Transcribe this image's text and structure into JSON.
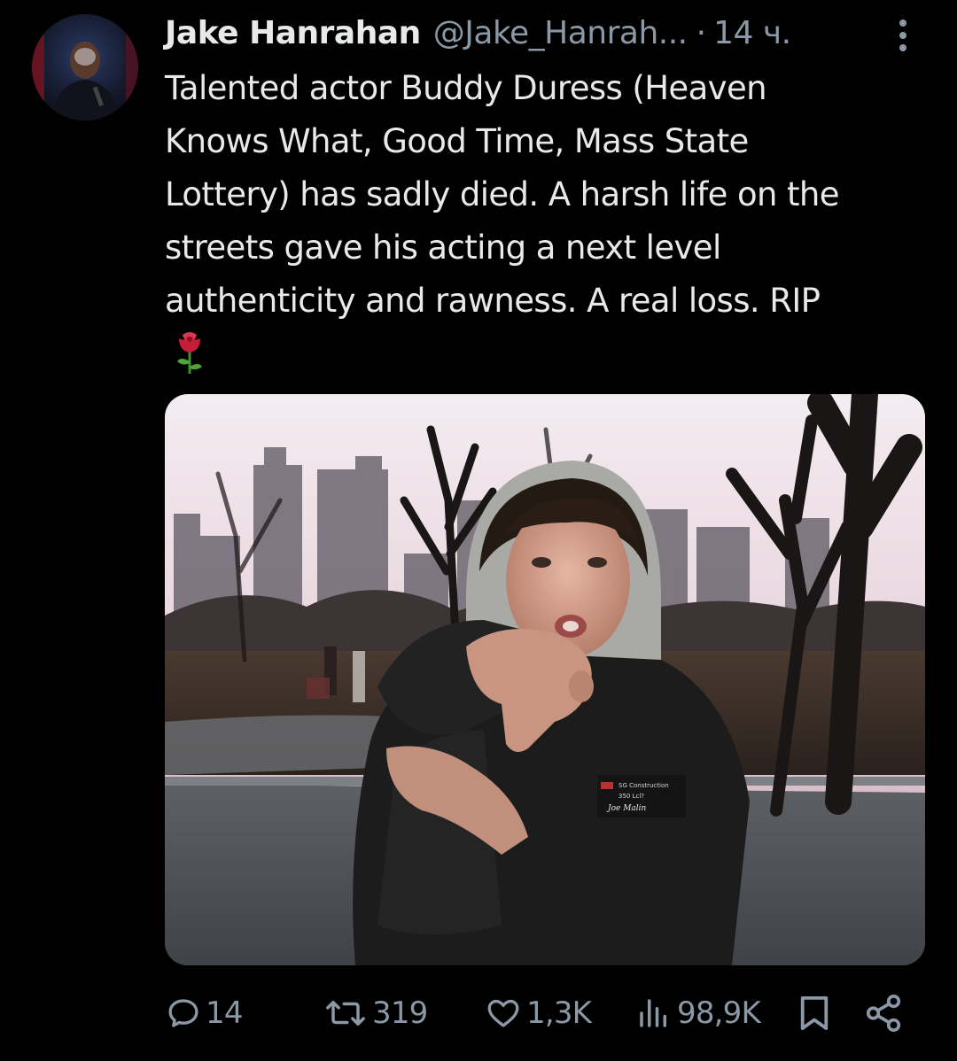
{
  "author": {
    "display_name": "Jake Hanrahan",
    "handle": "@Jake_Hanrah...",
    "separator": "·",
    "time": "14 ч."
  },
  "tweet": {
    "text": "Talented actor Buddy Duress (Heaven\nKnows What, Good Time, Mass State\nLottery) has sadly died. A harsh life on the\nstreets gave his acting a next level\nauthenticity and rawness. A real loss. RIP",
    "emoji": "rose"
  },
  "media": {
    "jacket_patch_lines": [
      "SG Construction",
      "350 Lcl?",
      "Joe Malin"
    ]
  },
  "actions": {
    "replies": "14",
    "retweets": "319",
    "likes": "1,3K",
    "views": "98,9K"
  },
  "icons": {
    "reply": "reply-icon",
    "retweet": "retweet-icon",
    "like": "heart-icon",
    "views": "views-icon",
    "bookmark": "bookmark-icon",
    "share": "share-icon",
    "more": "more-icon"
  },
  "colors": {
    "background": "#000000",
    "primary_text": "#e7e9ea",
    "secondary_text": "#8b98a5"
  }
}
